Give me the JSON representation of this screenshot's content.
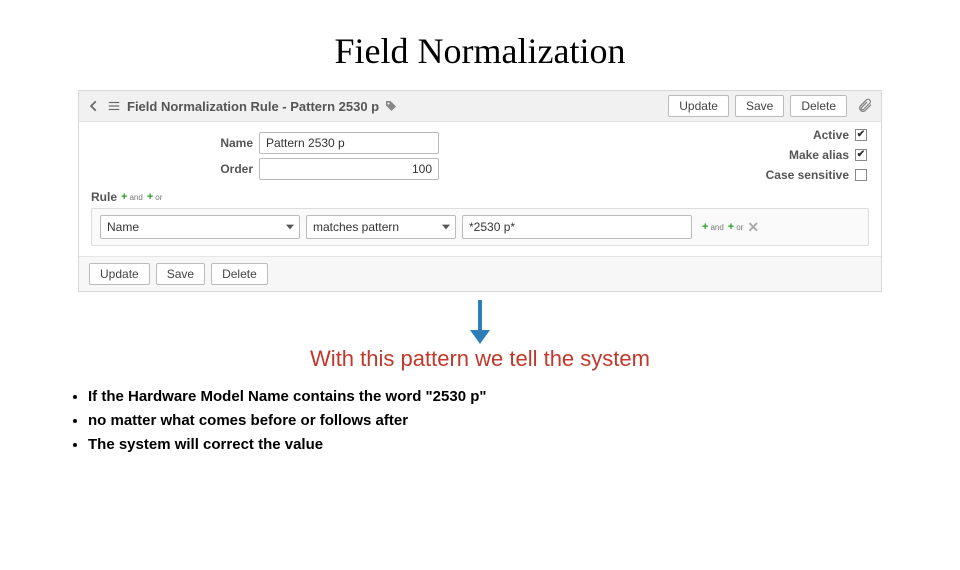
{
  "slide": {
    "title": "Field Normalization",
    "caption": "With this pattern we tell the system",
    "bullets": [
      "If the Hardware Model Name contains the word \"2530 p\"",
      "no matter what comes before or follows after",
      "The system will correct the value"
    ]
  },
  "panel": {
    "header_title": "Field Normalization Rule - Pattern 2530 p",
    "buttons": {
      "update": "Update",
      "save": "Save",
      "delete": "Delete"
    },
    "form": {
      "name_label": "Name",
      "name_value": "Pattern 2530 p",
      "order_label": "Order",
      "order_value": "100"
    },
    "checks": {
      "active_label": "Active",
      "active_checked": true,
      "alias_label": "Make alias",
      "alias_checked": true,
      "case_label": "Case sensitive",
      "case_checked": false
    },
    "rule": {
      "title": "Rule",
      "field_select": "Name",
      "operator_select": "matches pattern",
      "value": "*2530 p*",
      "and_label": "and",
      "or_label": "or"
    }
  },
  "colors": {
    "arrow": "#2e7fb8"
  }
}
